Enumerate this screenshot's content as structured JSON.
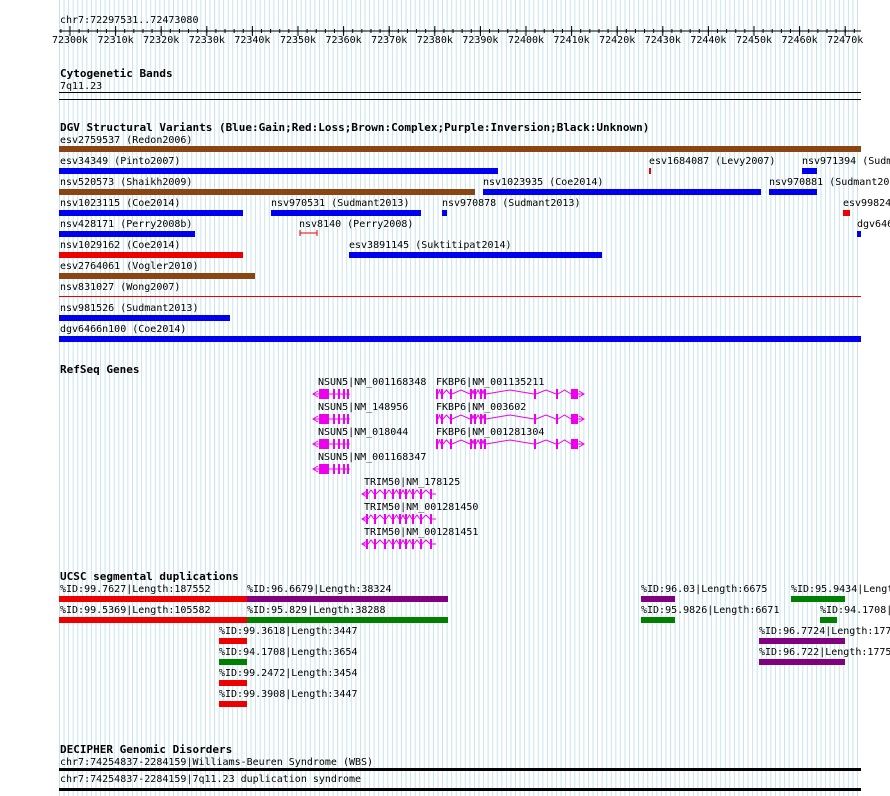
{
  "ruler": {
    "title": "chr7:72297531..72473080",
    "ticks": [
      "72300k",
      "72310k",
      "72320k",
      "72330k",
      "72340k",
      "72350k",
      "72360k",
      "72370k",
      "72380k",
      "72390k",
      "72400k",
      "72410k",
      "72420k",
      "72430k",
      "72440k",
      "72450k",
      "72460k",
      "72470k"
    ]
  },
  "cytoband": {
    "header": "Cytogenetic Bands",
    "band": "7q11.23"
  },
  "dgv": {
    "header": "DGV Structural Variants (Blue:Gain;Red:Loss;Brown:Complex;Purple:Inversion;Black:Unknown)",
    "features": [
      {
        "label": "esv2759537 (Redon2006)",
        "color": "#8b4513"
      },
      {
        "label": "esv34349 (Pinto2007)",
        "color": "#0000ee"
      },
      {
        "label": "esv1684087 (Levy2007)",
        "color": "#ee0000"
      },
      {
        "label": "nsv971394 (Sudm",
        "color": "#0000ee"
      },
      {
        "label": "nsv520573 (Shaikh2009)",
        "color": "#8b4513"
      },
      {
        "label": "nsv1023935 (Coe2014)",
        "color": "#0000ee"
      },
      {
        "label": "nsv970881 (Sudmant20",
        "color": "#0000ee"
      },
      {
        "label": "nsv1023115 (Coe2014)",
        "color": "#0000ee"
      },
      {
        "label": "nsv970531 (Sudmant2013)",
        "color": "#0000ee"
      },
      {
        "label": "nsv970878 (Sudmant2013)",
        "color": "#0000ee"
      },
      {
        "label": "esv99824",
        "color": "#ee0000"
      },
      {
        "label": "nsv428171 (Perry2008b)",
        "color": "#0000ee"
      },
      {
        "label": "nsv8140 (Perry2008)",
        "color": "#ee0000"
      },
      {
        "label": "dgv646",
        "color": "#0000ee"
      },
      {
        "label": "nsv1029162 (Coe2014)",
        "color": "#ee0000"
      },
      {
        "label": "esv3891145 (Suktitipat2014)",
        "color": "#0000ee"
      },
      {
        "label": "esv2764061 (Vogler2010)",
        "color": "#8b4513"
      },
      {
        "label": "nsv831027 (Wong2007)",
        "color": "#8b4513"
      },
      {
        "label": "nsv981526 (Sudmant2013)",
        "color": "#0000ee"
      },
      {
        "label": "dgv6466n100 (Coe2014)",
        "color": "#0000ee"
      }
    ]
  },
  "refseq": {
    "header": "RefSeq Genes",
    "color": "#ee00ee",
    "genes": [
      "NSUN5|NM_001168348",
      "FKBP6|NM_001135211",
      "NSUN5|NM_148956",
      "FKBP6|NM_003602",
      "NSUN5|NM_018044",
      "FKBP6|NM_001281304",
      "NSUN5|NM_001168347",
      "TRIM50|NM_178125",
      "TRIM50|NM_001281450",
      "TRIM50|NM_001281451"
    ]
  },
  "segdups": {
    "header": "UCSC segmental duplications",
    "features": [
      {
        "label": "%ID:99.7627|Length:187552",
        "color": "#ee0000"
      },
      {
        "label": "%ID:96.6679|Length:38324",
        "color": "#800080"
      },
      {
        "label": "%ID:96.03|Length:6675",
        "color": "#800080"
      },
      {
        "label": "%ID:95.9434|Lengt",
        "color": "#008000"
      },
      {
        "label": "%ID:99.5369|Length:105582",
        "color": "#ee0000"
      },
      {
        "label": "%ID:95.829|Length:38288",
        "color": "#008000"
      },
      {
        "label": "%ID:95.9826|Length:6671",
        "color": "#008000"
      },
      {
        "label": "%ID:94.1708|",
        "color": "#008000"
      },
      {
        "label": "%ID:99.3618|Length:3447",
        "color": "#ee0000"
      },
      {
        "label": "%ID:96.7724|Length:177",
        "color": "#800080"
      },
      {
        "label": "%ID:94.1708|Length:3654",
        "color": "#008000"
      },
      {
        "label": "%ID:96.722|Length:1775",
        "color": "#800080"
      },
      {
        "label": "%ID:99.2472|Length:3454",
        "color": "#ee0000"
      },
      {
        "label": "%ID:99.3908|Length:3447",
        "color": "#ee0000"
      }
    ]
  },
  "decipher": {
    "header": "DECIPHER Genomic Disorders",
    "features": [
      {
        "label": "chr7:74254837-2284159|Williams-Beuren Syndrome (WBS)",
        "color": "#000000"
      },
      {
        "label": "chr7:74254837-2284159|7q11.23 duplication syndrome",
        "color": "#000000"
      }
    ]
  }
}
